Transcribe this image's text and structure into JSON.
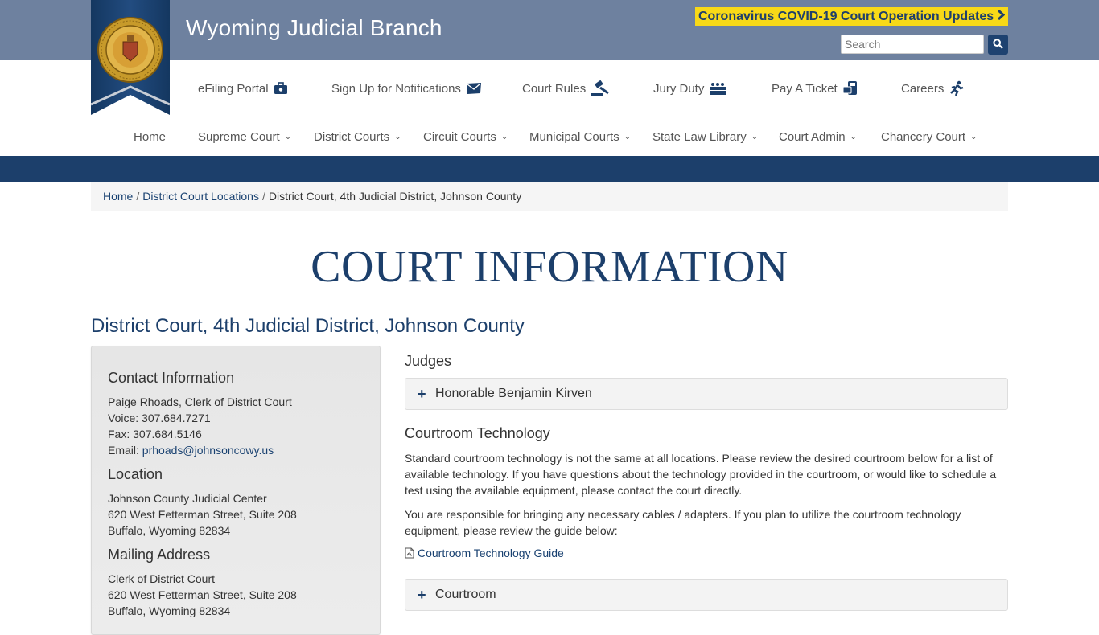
{
  "header": {
    "title": "Wyoming Judicial Branch",
    "covid_link": "Coronavirus COVID-19 Court Operation Updates",
    "search_placeholder": "Search",
    "accent": "#f8d917",
    "bar_color": "#6e819f",
    "brand": "#1c3f6b"
  },
  "quick_links": [
    {
      "label": "eFiling Portal",
      "icon": "briefcase-icon"
    },
    {
      "label": "Sign Up for Notifications",
      "icon": "envelope-icon"
    },
    {
      "label": "Court Rules",
      "icon": "gavel-icon"
    },
    {
      "label": "Jury Duty",
      "icon": "jury-icon"
    },
    {
      "label": "Pay A Ticket",
      "icon": "payment-icon"
    },
    {
      "label": "Careers",
      "icon": "runner-icon"
    }
  ],
  "nav": [
    {
      "label": "Home",
      "dropdown": false
    },
    {
      "label": "Supreme Court",
      "dropdown": true
    },
    {
      "label": "District Courts",
      "dropdown": true
    },
    {
      "label": "Circuit Courts",
      "dropdown": true
    },
    {
      "label": "Municipal Courts",
      "dropdown": true
    },
    {
      "label": "State Law Library",
      "dropdown": true
    },
    {
      "label": "Court Admin",
      "dropdown": true
    },
    {
      "label": "Chancery Court",
      "dropdown": true
    }
  ],
  "breadcrumb": {
    "home": "Home",
    "sep": "/",
    "parent": "District Court Locations",
    "current": "District Court, 4th Judicial District, Johnson County"
  },
  "page_heading": "COURT INFORMATION",
  "court_name": "District Court, 4th Judicial District, Johnson County",
  "contact": {
    "heading": "Contact Information",
    "name": "Paige Rhoads, Clerk of District Court",
    "voice": "Voice: 307.684.7271",
    "fax": "Fax: 307.684.5146",
    "email_label": "Email: ",
    "email": "prhoads@johnsoncowy.us"
  },
  "location": {
    "heading": "Location",
    "line1": "Johnson County Judicial Center",
    "line2": "620 West Fetterman Street, Suite 208",
    "line3": "Buffalo, Wyoming 82834"
  },
  "mailing": {
    "heading": "Mailing Address",
    "line1": "Clerk of District Court",
    "line2": "620 West Fetterman Street, Suite 208",
    "line3": "Buffalo, Wyoming 82834"
  },
  "judges": {
    "heading": "Judges",
    "judge": "Honorable Benjamin Kirven"
  },
  "tech": {
    "heading": "Courtroom Technology",
    "para1": "Standard courtroom technology is not the same at all locations. Please review the desired courtroom below for a list of available technology. If you have questions about the technology provided in the courtroom, or would like to schedule a test using the available equipment, please contact the court directly.",
    "para2": "You are responsible for bringing any necessary cables / adapters. If you plan to utilize the courtroom technology equipment, please review the guide below:",
    "guide": "Courtroom Technology Guide",
    "courtroom": "Courtroom"
  }
}
